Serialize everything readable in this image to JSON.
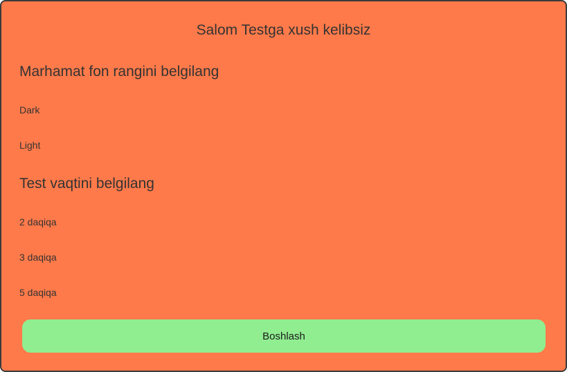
{
  "title": "Salom Testga xush kelibsiz",
  "background_section": {
    "heading": "Marhamat fon rangini belgilang",
    "options": [
      "Dark",
      "Light"
    ]
  },
  "time_section": {
    "heading": "Test vaqtini belgilang",
    "options": [
      "2 daqiqa",
      "3 daqiqa",
      "5 daqiqa"
    ]
  },
  "start_button": {
    "label": "Boshlash"
  },
  "colors": {
    "panel_background": "#ff7a4a",
    "button_background": "#90ee90",
    "text": "#333333"
  }
}
